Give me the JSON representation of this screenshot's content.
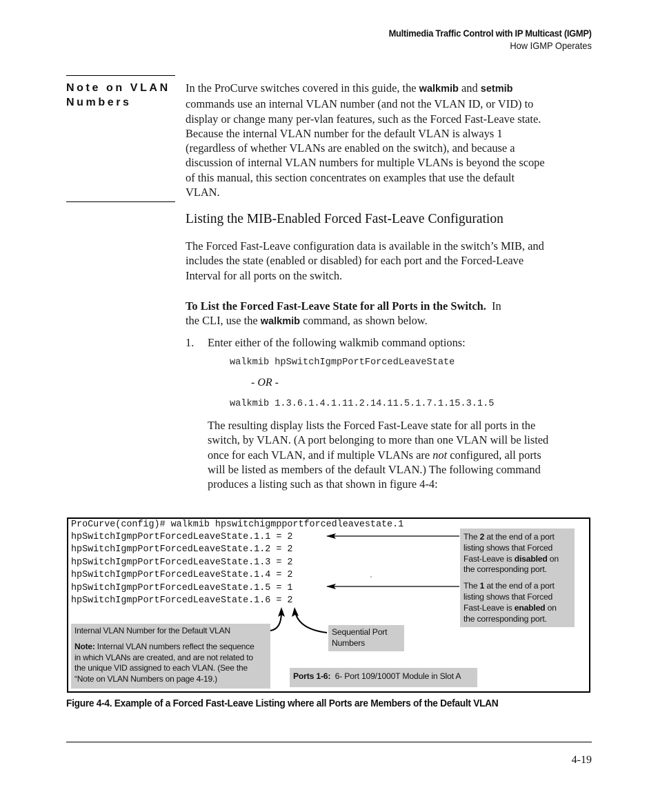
{
  "header": {
    "chapter_title": "Multimedia Traffic Control with IP Multicast (IGMP)",
    "section_title": "How IGMP Operates"
  },
  "note": {
    "heading_line1": "Note on VLAN",
    "heading_line2": "Numbers",
    "lines": [
      [
        "In the ProCurve switches covered in this guide, the ",
        {
          "kw": "walkmib"
        },
        " and ",
        {
          "kw": "setmib"
        }
      ],
      [
        "commands use an internal VLAN number (and not the VLAN ID, or VID) to"
      ],
      [
        "display or change many per-vlan features, such as the Forced Fast-Leave state."
      ],
      [
        "Because the internal VLAN number for the default VLAN is always 1"
      ],
      [
        "(regardless of whether VLANs are enabled on the switch), and because a"
      ],
      [
        "discussion of internal VLAN numbers for multiple VLANs is beyond the scope"
      ],
      [
        "of this manual, this section concentrates on examples that use the default"
      ],
      [
        "VLAN."
      ]
    ]
  },
  "section": {
    "title": "Listing the MIB-Enabled Forced Fast-Leave Configuration",
    "intro_lines": [
      "The Forced Fast-Leave configuration data is available in the switch’s MIB, and",
      "includes the state (enabled or disabled) for each port and the Forced-Leave",
      "Interval for all ports on the switch."
    ],
    "procedure_heading": "To List the Forced Fast-Leave State for all Ports in the Switch.",
    "procedure_line1_rest": "In",
    "procedure_line2_pre": "the CLI, use the ",
    "procedure_line2_kw": "walkmib",
    "procedure_line2_post": " command, as shown below.",
    "step_number": "1.",
    "step_text": "Enter either of the following walkmib command options:",
    "command_option_1": "walkmib hpSwitchIgmpPortForcedLeaveState",
    "or_label": "- OR -",
    "command_option_2": "walkmib 1.3.6.1.4.1.11.2.14.11.5.1.7.1.15.3.1.5",
    "result_lines": [
      [
        "The resulting display lists the Forced Fast-Leave state for all ports in the"
      ],
      [
        "switch, by VLAN. (A port belonging to more than one VLAN will be listed"
      ],
      [
        "once for each VLAN, and if multiple VLANs are ",
        {
          "em": "not"
        },
        " configured, all ports"
      ],
      [
        "will be listed as members of the default VLAN.) The following command"
      ],
      [
        "produces a listing such as that shown in figure 4-4:"
      ]
    ]
  },
  "figure": {
    "cli_prompt_line": "ProCurve(config)# walkmib hpswitchigmpportforcedleavestate.1",
    "cli_output": [
      {
        "oid": "hpSwitchIgmpPortForcedLeaveState.1.1",
        "value": "2"
      },
      {
        "oid": "hpSwitchIgmpPortForcedLeaveState.1.2",
        "value": "2"
      },
      {
        "oid": "hpSwitchIgmpPortForcedLeaveState.1.3",
        "value": "2"
      },
      {
        "oid": "hpSwitchIgmpPortForcedLeaveState.1.4",
        "value": "2"
      },
      {
        "oid": "hpSwitchIgmpPortForcedLeaveState.1.5",
        "value": "1"
      },
      {
        "oid": "hpSwitchIgmpPortForcedLeaveState.1.6",
        "value": "2"
      }
    ],
    "callout_disabled": {
      "l1_pre": "The ",
      "l1_bold": "2",
      "l1_post": " at the end of a port",
      "l2": "listing shows that Forced",
      "l3_pre": "Fast-Leave is ",
      "l3_bold": "disabled",
      "l3_post": " on",
      "l4": "the corresponding port."
    },
    "callout_enabled": {
      "l1_pre": "The ",
      "l1_bold": "1",
      "l1_post": " at the end of a port",
      "l2": "listing shows that Forced",
      "l3_pre": "Fast-Leave is ",
      "l3_bold": "enabled",
      "l3_post": " on",
      "l4": "the corresponding port."
    },
    "callout_internal_vlan": {
      "title": "Internal VLAN Number for the Default VLAN",
      "note_label": "Note:",
      "note_l1": " Internal VLAN numbers reflect the sequence",
      "note_l2": "in which VLANs are created, and are not related to",
      "note_l3": "the unique VID assigned to each VLAN. (See the",
      "note_l4": "“Note on VLAN Numbers on page 4-19.)"
    },
    "callout_sequential": {
      "l1": "Sequential Port",
      "l2": "Numbers"
    },
    "callout_ports": {
      "label": "Ports 1-6:",
      "text": "  6- Port 109/1000T Module in Slot A"
    },
    "caption": "Figure 4-4.  Example of a Forced Fast-Leave Listing where all Ports are Members of the Default VLAN"
  },
  "footer": {
    "page_number": "4-19"
  }
}
